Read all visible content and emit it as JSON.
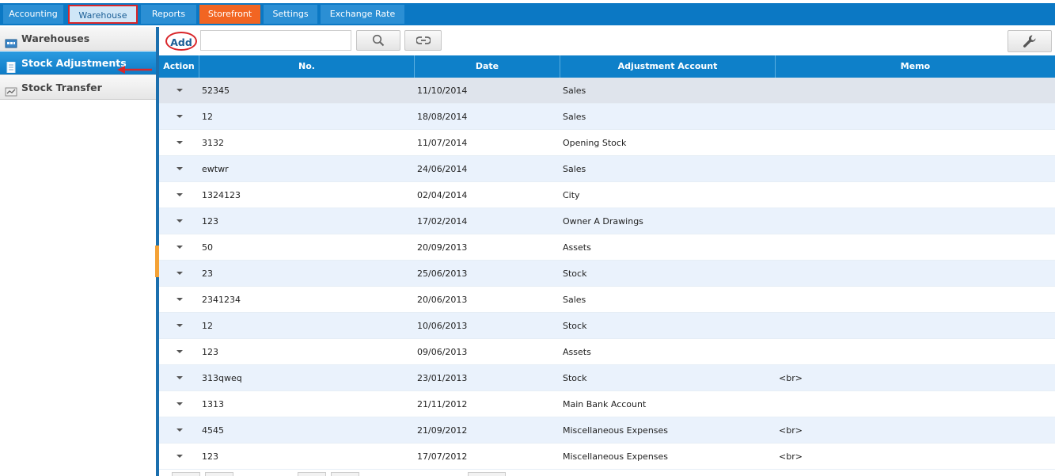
{
  "topnav": {
    "tabs": [
      {
        "label": "Accounting"
      },
      {
        "label": "Warehouse"
      },
      {
        "label": "Reports"
      },
      {
        "label": "Storefront"
      },
      {
        "label": "Settings"
      },
      {
        "label": "Exchange Rate"
      }
    ],
    "active_tab": "Warehouse"
  },
  "sidebar": {
    "items": [
      {
        "label": "Warehouses",
        "icon": "warehouse-icon"
      },
      {
        "label": "Stock Adjustments",
        "icon": "document-icon"
      },
      {
        "label": "Stock Transfer",
        "icon": "transfer-icon"
      }
    ],
    "active_item": "Stock Adjustments"
  },
  "toolbar": {
    "add_label": "Add",
    "search_value": "",
    "search_icon": "search-icon",
    "reset_icon": "link-icon",
    "settings_icon": "wrench-icon"
  },
  "table": {
    "columns": [
      "Action",
      "No.",
      "Date",
      "Adjustment Account",
      "Memo"
    ],
    "rows": [
      {
        "no": "52345",
        "date": "11/10/2014",
        "account": "Sales",
        "memo": ""
      },
      {
        "no": "12",
        "date": "18/08/2014",
        "account": "Sales",
        "memo": ""
      },
      {
        "no": "3132",
        "date": "11/07/2014",
        "account": "Opening Stock",
        "memo": ""
      },
      {
        "no": "ewtwr",
        "date": "24/06/2014",
        "account": "Sales",
        "memo": ""
      },
      {
        "no": "1324123",
        "date": "02/04/2014",
        "account": "City",
        "memo": ""
      },
      {
        "no": "123",
        "date": "17/02/2014",
        "account": "Owner A Drawings",
        "memo": ""
      },
      {
        "no": "50",
        "date": "20/09/2013",
        "account": "Assets",
        "memo": ""
      },
      {
        "no": "23",
        "date": "25/06/2013",
        "account": "Stock",
        "memo": ""
      },
      {
        "no": "2341234",
        "date": "20/06/2013",
        "account": "Sales",
        "memo": ""
      },
      {
        "no": "12",
        "date": "10/06/2013",
        "account": "Stock",
        "memo": ""
      },
      {
        "no": "123",
        "date": "09/06/2013",
        "account": "Assets",
        "memo": ""
      },
      {
        "no": "313qweq",
        "date": "23/01/2013",
        "account": "Stock",
        "memo": "<br>"
      },
      {
        "no": "1313",
        "date": "21/11/2012",
        "account": "Main Bank Account",
        "memo": ""
      },
      {
        "no": "4545",
        "date": "21/09/2012",
        "account": "Miscellaneous Expenses",
        "memo": "<br>"
      },
      {
        "no": "123",
        "date": "17/07/2012",
        "account": "Miscellaneous Expenses",
        "memo": "<br>"
      }
    ]
  },
  "colors": {
    "topbar": "#0b78c4",
    "header": "#0e80c9",
    "storefront": "#f26522",
    "annotation": "#d9262a"
  }
}
